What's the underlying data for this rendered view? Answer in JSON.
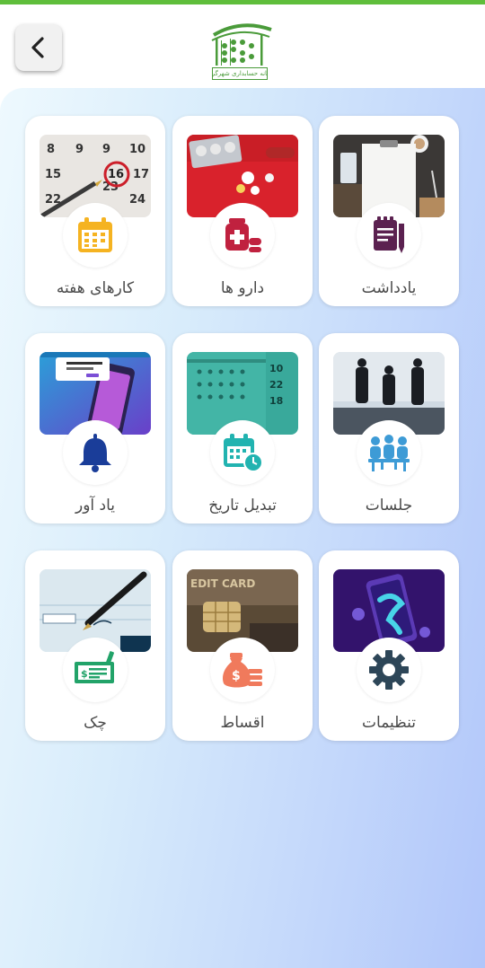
{
  "header": {
    "logo_text": "خانه حسابداری شهرگرد",
    "back_icon": "chevron-left-icon"
  },
  "colors": {
    "accent_stripe": "#5fbe3b",
    "logo_green": "#4a9b3a"
  },
  "grid": {
    "cards": [
      {
        "name": "notes",
        "label": "یادداشت",
        "icon": "note-pen-icon",
        "icon_color": "#5b2150"
      },
      {
        "name": "medicines",
        "label": "دارو ها",
        "icon": "medicine-bottle-icon",
        "icon_color": "#c0213f"
      },
      {
        "name": "weekly-tasks",
        "label": "کارهای هفته",
        "icon": "calendar-icon",
        "icon_color": "#f5b321"
      },
      {
        "name": "meetings",
        "label": "جلسات",
        "icon": "meeting-people-icon",
        "icon_color": "#3d9bd6"
      },
      {
        "name": "date-convert",
        "label": "تبدیل تاریخ",
        "icon": "calendar-clock-icon",
        "icon_color": "#21b3b0"
      },
      {
        "name": "reminder",
        "label": "یاد آور",
        "icon": "bell-icon",
        "icon_color": "#1a3d99"
      },
      {
        "name": "settings",
        "label": "تنظیمات",
        "icon": "gear-icon",
        "icon_color": "#2d4658"
      },
      {
        "name": "installments",
        "label": "اقساط",
        "icon": "money-bag-icon",
        "icon_color": "#f07a5c"
      },
      {
        "name": "check",
        "label": "چک",
        "icon": "cheque-icon",
        "icon_color": "#22a369"
      }
    ]
  }
}
